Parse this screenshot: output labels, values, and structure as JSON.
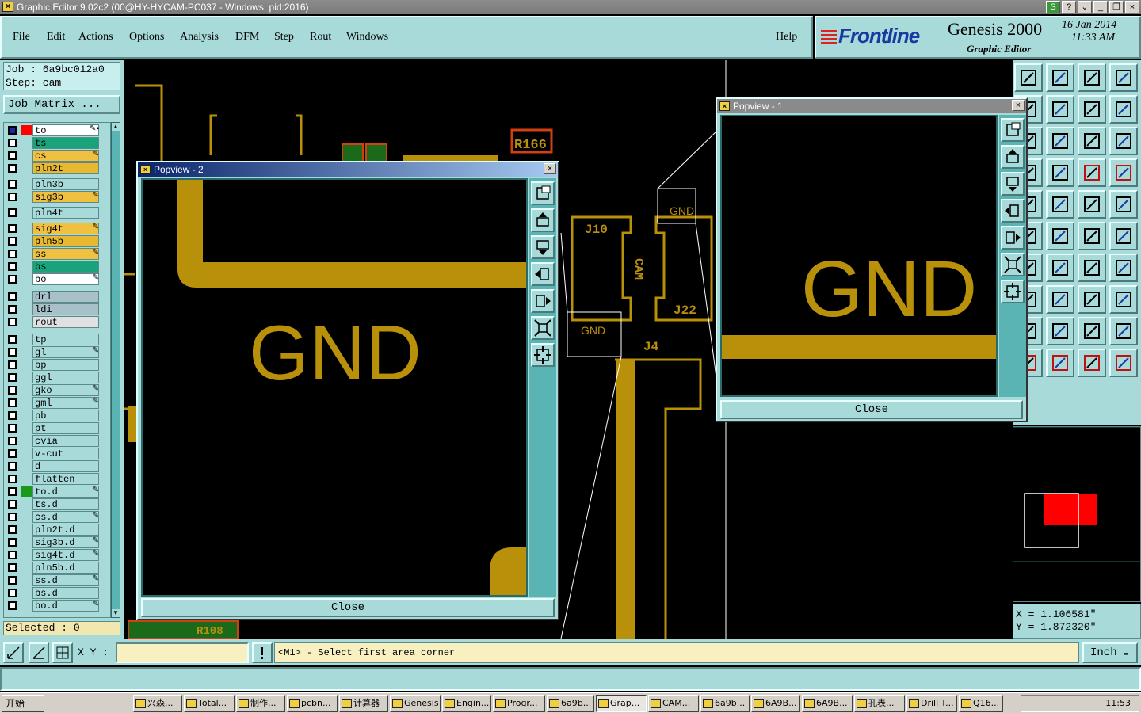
{
  "window": {
    "title": "Graphic Editor 9.02c2 (00@HY-HYCAM-PC037 - Windows, pid:2016)"
  },
  "menu": [
    "File",
    "Edit",
    "Actions",
    "Options",
    "Analysis",
    "DFM",
    "Step",
    "Rout",
    "Windows"
  ],
  "help_label": "Help",
  "brand": {
    "logo": "Frontline",
    "product": "Genesis 2000",
    "subtitle": "Graphic Editor",
    "date": "16 Jan 2014",
    "time": "11:33 AM"
  },
  "job": {
    "job_line": "Job : 6a9bc012a0",
    "step_line": "Step: cam",
    "matrix_button": "Job Matrix ..."
  },
  "layers": [
    {
      "name": "to",
      "color": "#ffffff",
      "swatch": "#ff0000",
      "mark": "✎▪"
    },
    {
      "name": "ts",
      "color": "#1aa37a",
      "swatch": "",
      "mark": ""
    },
    {
      "name": "cs",
      "color": "#f0c040",
      "swatch": "",
      "mark": "✎"
    },
    {
      "name": "pln2t",
      "color": "#e8b830",
      "swatch": "",
      "mark": ""
    },
    {
      "name": "pln3b",
      "color": "#a8dada",
      "swatch": "",
      "mark": ""
    },
    {
      "name": "sig3b",
      "color": "#f0c040",
      "swatch": "",
      "mark": "✎"
    },
    {
      "name": "pln4t",
      "color": "#a8dada",
      "swatch": "",
      "mark": ""
    },
    {
      "name": "sig4t",
      "color": "#f0c040",
      "swatch": "",
      "mark": "✎"
    },
    {
      "name": "pln5b",
      "color": "#e8b830",
      "swatch": "",
      "mark": ""
    },
    {
      "name": "ss",
      "color": "#f0c040",
      "swatch": "",
      "mark": "✎"
    },
    {
      "name": "bs",
      "color": "#1aa37a",
      "swatch": "",
      "mark": ""
    },
    {
      "name": "bo",
      "color": "#ffffff",
      "swatch": "",
      "mark": "✎"
    },
    {
      "name": "drl",
      "color": "#a8c0c8",
      "swatch": "",
      "mark": ""
    },
    {
      "name": "ldi",
      "color": "#a8c0c8",
      "swatch": "",
      "mark": ""
    },
    {
      "name": "rout",
      "color": "#e0e0e0",
      "swatch": "",
      "mark": ""
    },
    {
      "name": "tp",
      "color": "#a8dada",
      "swatch": "",
      "mark": ""
    },
    {
      "name": "gl",
      "color": "#a8dada",
      "swatch": "",
      "mark": "✎"
    },
    {
      "name": "bp",
      "color": "#a8dada",
      "swatch": "",
      "mark": ""
    },
    {
      "name": "ggl",
      "color": "#a8dada",
      "swatch": "",
      "mark": ""
    },
    {
      "name": "gko",
      "color": "#a8dada",
      "swatch": "",
      "mark": "✎"
    },
    {
      "name": "gml",
      "color": "#a8dada",
      "swatch": "",
      "mark": "✎"
    },
    {
      "name": "pb",
      "color": "#a8dada",
      "swatch": "",
      "mark": ""
    },
    {
      "name": "pt",
      "color": "#a8dada",
      "swatch": "",
      "mark": ""
    },
    {
      "name": "cvia",
      "color": "#a8dada",
      "swatch": "",
      "mark": ""
    },
    {
      "name": "v-cut",
      "color": "#a8dada",
      "swatch": "",
      "mark": ""
    },
    {
      "name": "d",
      "color": "#a8dada",
      "swatch": "",
      "mark": ""
    },
    {
      "name": "flatten",
      "color": "#a8dada",
      "swatch": "",
      "mark": ""
    },
    {
      "name": "to.d",
      "color": "#a8dada",
      "swatch": "#1a9a1a",
      "mark": "✎"
    },
    {
      "name": "ts.d",
      "color": "#a8dada",
      "swatch": "",
      "mark": ""
    },
    {
      "name": "cs.d",
      "color": "#a8dada",
      "swatch": "",
      "mark": "✎"
    },
    {
      "name": "pln2t.d",
      "color": "#a8dada",
      "swatch": "",
      "mark": ""
    },
    {
      "name": "sig3b.d",
      "color": "#a8dada",
      "swatch": "",
      "mark": "✎"
    },
    {
      "name": "sig4t.d",
      "color": "#a8dada",
      "swatch": "",
      "mark": "✎"
    },
    {
      "name": "pln5b.d",
      "color": "#a8dada",
      "swatch": "",
      "mark": ""
    },
    {
      "name": "ss.d",
      "color": "#a8dada",
      "swatch": "",
      "mark": "✎"
    },
    {
      "name": "bs.d",
      "color": "#a8dada",
      "swatch": "",
      "mark": ""
    },
    {
      "name": "bo.d",
      "color": "#a8dada",
      "swatch": "",
      "mark": "✎"
    }
  ],
  "selected_label": "Selected : 0",
  "canvas_labels": {
    "r166": "R166",
    "j10": "J10",
    "j22": "J22",
    "j4": "J4",
    "cam": "CAM",
    "gnd_a": "GND",
    "gnd_b": "GND",
    "r108": "R108"
  },
  "popup1": {
    "title": "Popview - 1",
    "text": "GND",
    "close": "Close"
  },
  "popup2": {
    "title": "Popview - 2",
    "text": "GND",
    "close": "Close"
  },
  "coordinates": {
    "x": "X = 1.106581\"",
    "y": "Y = 1.872320\""
  },
  "xy_label": "X Y :",
  "xy_value": "",
  "prompt": "<M1> - Select first area corner",
  "units": "Inch",
  "taskbar": {
    "start": "开始",
    "tasks": [
      "兴森...",
      "Total...",
      "制作...",
      "pcbn...",
      "计算器",
      "Genesis",
      "Engin...",
      "Progr...",
      "6a9b...",
      "Grap...",
      "CAM...",
      "6a9b...",
      "6A9B...",
      "6A9B...",
      "孔表...",
      "Drill T...",
      "Q16..."
    ],
    "clock": "11:53"
  },
  "colors": {
    "trace": "#b8900a",
    "panel": "#a8dada",
    "popup_title": "#8a8a8a",
    "highlight_red": "#ff0000"
  }
}
